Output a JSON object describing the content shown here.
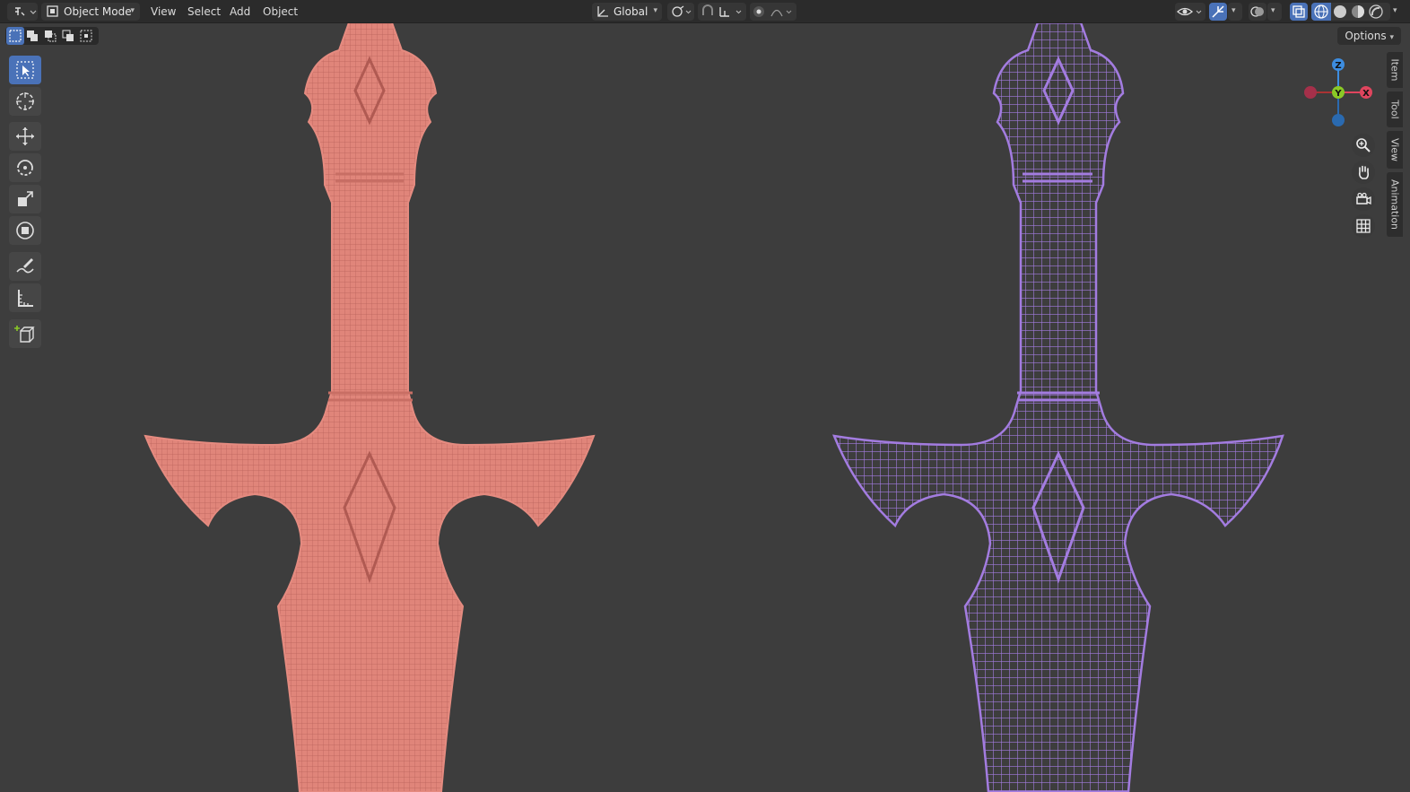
{
  "header": {
    "mode_label": "Object Mode",
    "menus": [
      "View",
      "Select",
      "Add",
      "Object"
    ],
    "transform_orientation": "Global"
  },
  "viewport": {
    "options_label": "Options",
    "gizmo_axes": {
      "z": "Z",
      "y": "Y",
      "x": "X"
    },
    "side_tabs": [
      "Item",
      "Tool",
      "View",
      "Animation"
    ]
  },
  "colors": {
    "background": "#3d3d3d",
    "header_bg": "#2b2b2b",
    "active_tool": "#4a72b8",
    "left_mesh": "#e0857a",
    "right_mesh": "#a37ce0",
    "axis_x": "#e0455e",
    "axis_y": "#8ac926",
    "axis_z": "#3d8de0"
  },
  "tools": [
    {
      "name": "select-box-tool",
      "icon": "select-box-icon"
    },
    {
      "name": "cursor-tool",
      "icon": "cursor-icon"
    },
    {
      "name": "move-tool",
      "icon": "move-icon"
    },
    {
      "name": "rotate-tool",
      "icon": "rotate-icon"
    },
    {
      "name": "scale-tool",
      "icon": "scale-icon"
    },
    {
      "name": "transform-tool",
      "icon": "transform-icon"
    },
    {
      "name": "annotate-tool",
      "icon": "annotate-icon"
    },
    {
      "name": "measure-tool",
      "icon": "measure-icon"
    },
    {
      "name": "add-cube-tool",
      "icon": "add-cube-icon"
    }
  ]
}
